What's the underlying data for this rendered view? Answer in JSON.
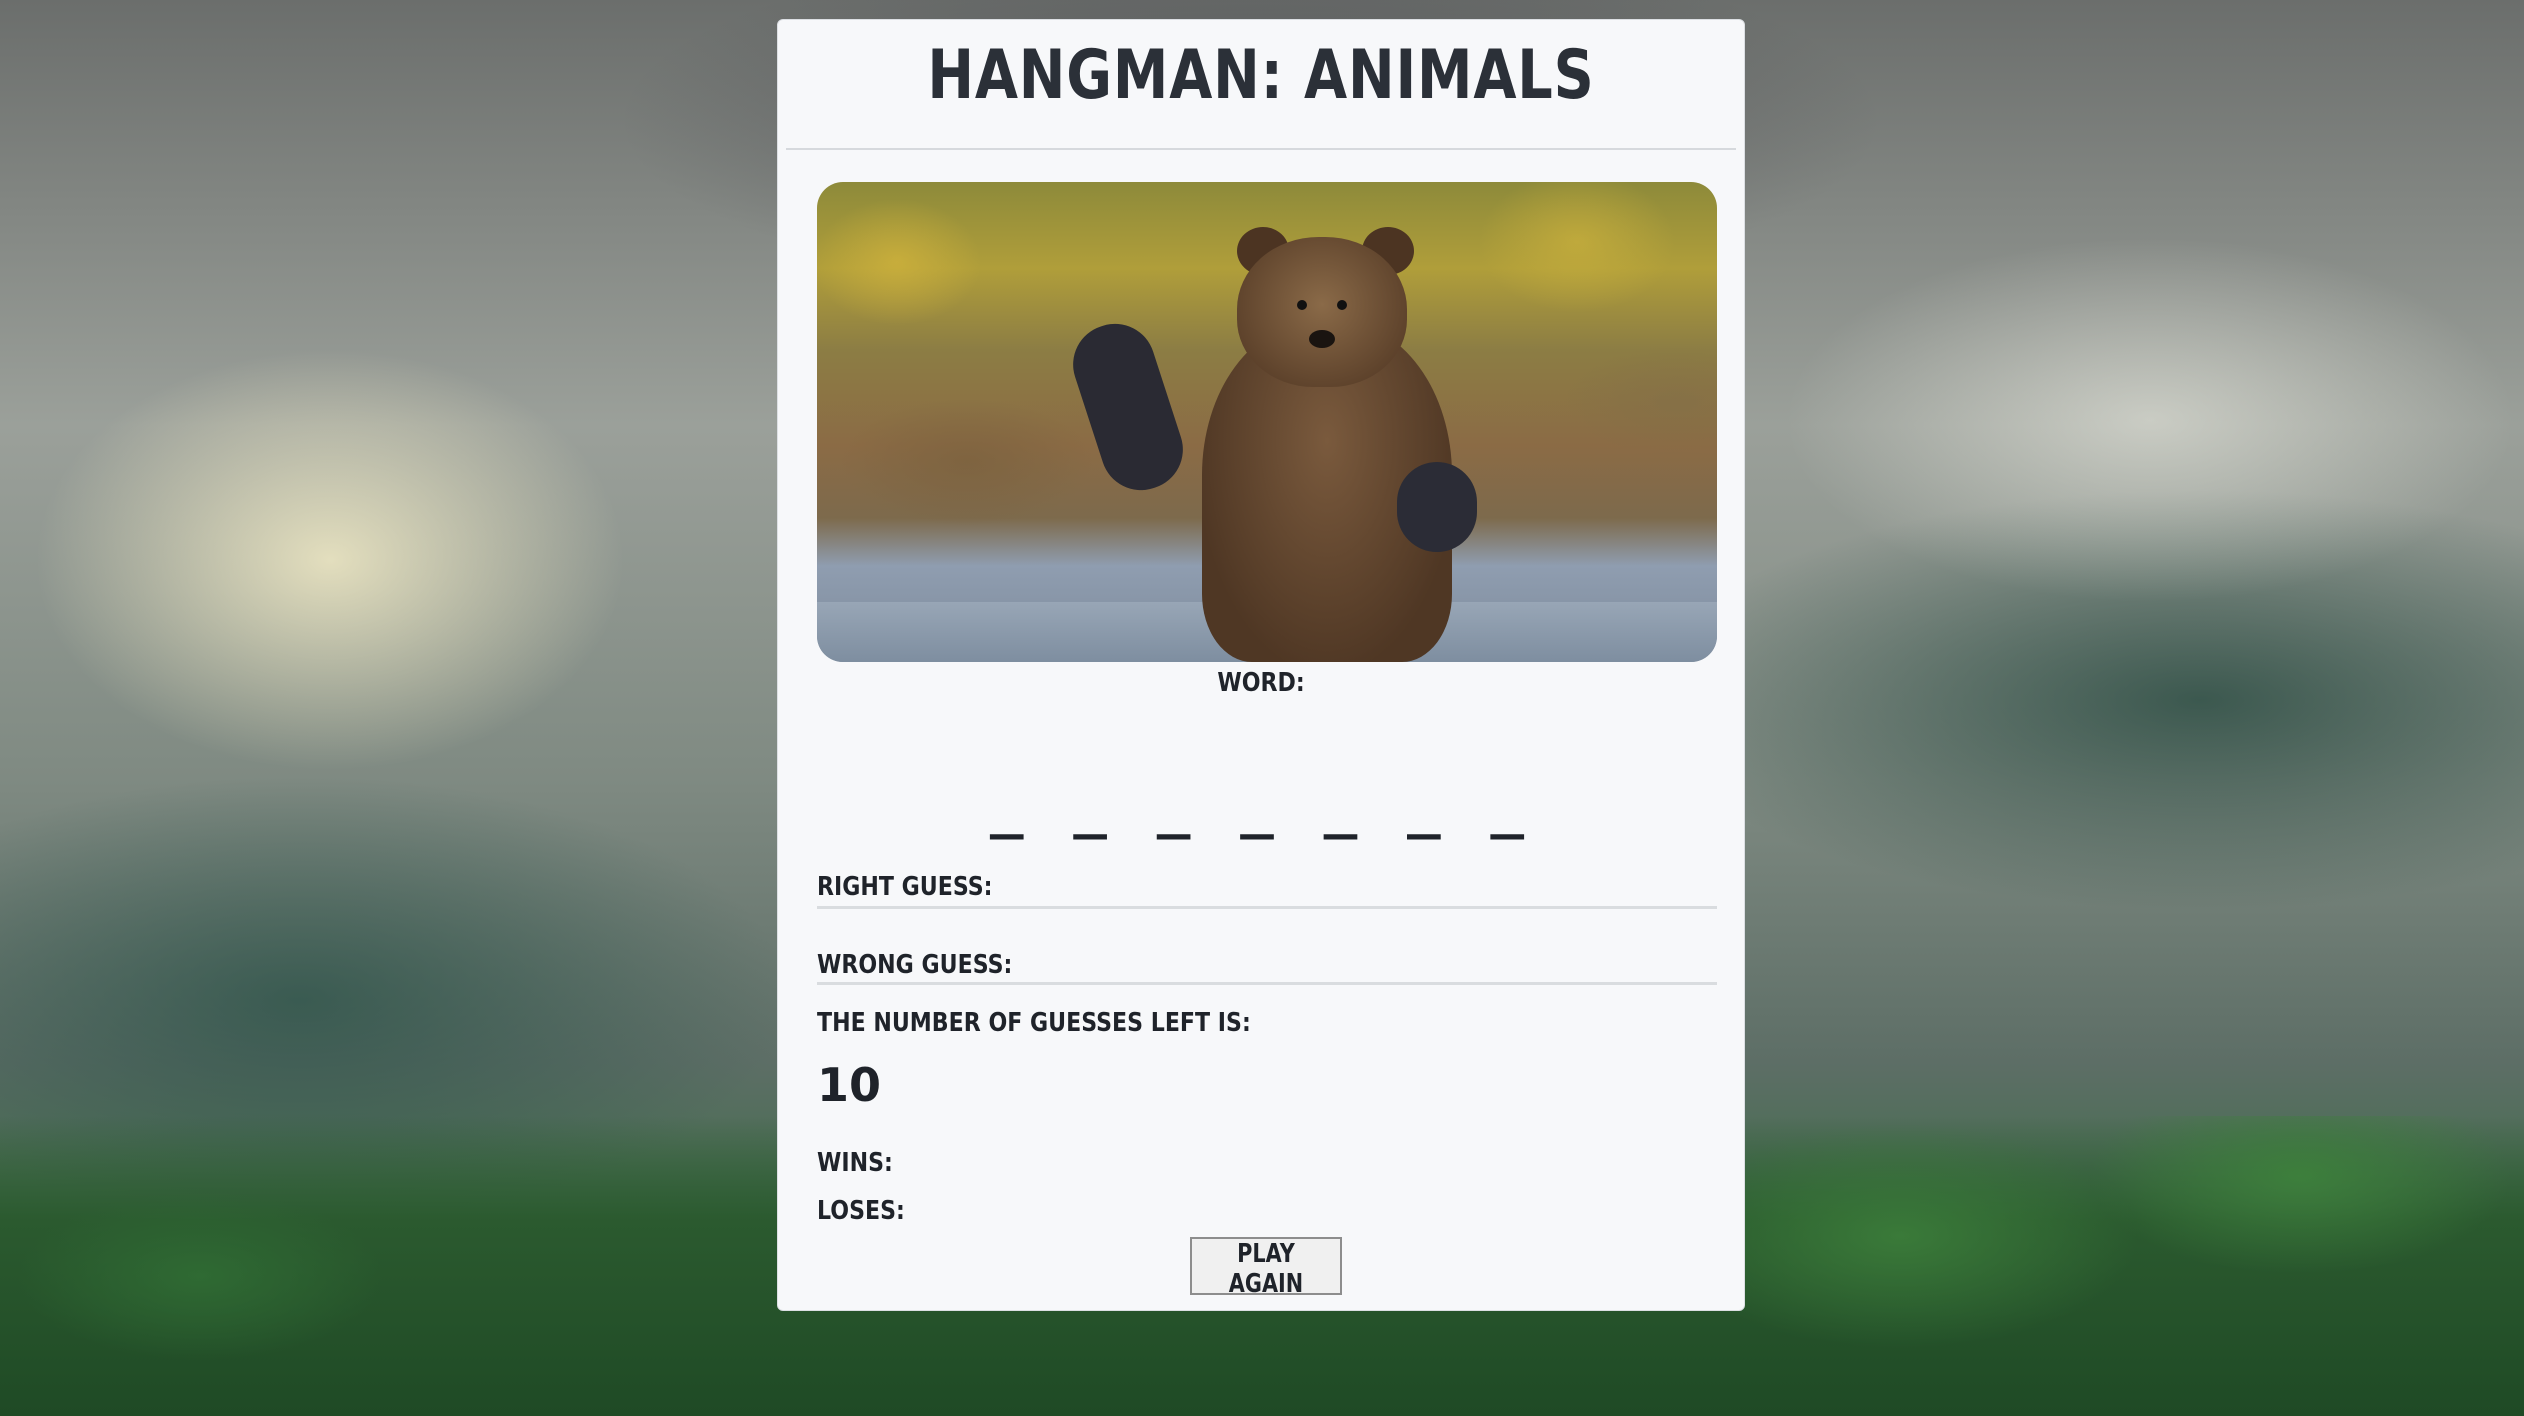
{
  "game": {
    "title": "Hangman: Animals",
    "image_alt": "Brown bear standing in water waving a paw",
    "word_label": "Word:",
    "word_blanks": "_ _ _ _ _ _ _",
    "right_guess_label": "Right Guess:",
    "right_guess_value": "",
    "wrong_guess_label": "Wrong Guess:",
    "wrong_guess_value": "",
    "guesses_left_label": "The number of guesses left is:",
    "guesses_left": "10",
    "wins_label": "Wins:",
    "wins_value": "",
    "loses_label": "Loses:",
    "loses_value": "",
    "play_again_label": "Play Again"
  }
}
